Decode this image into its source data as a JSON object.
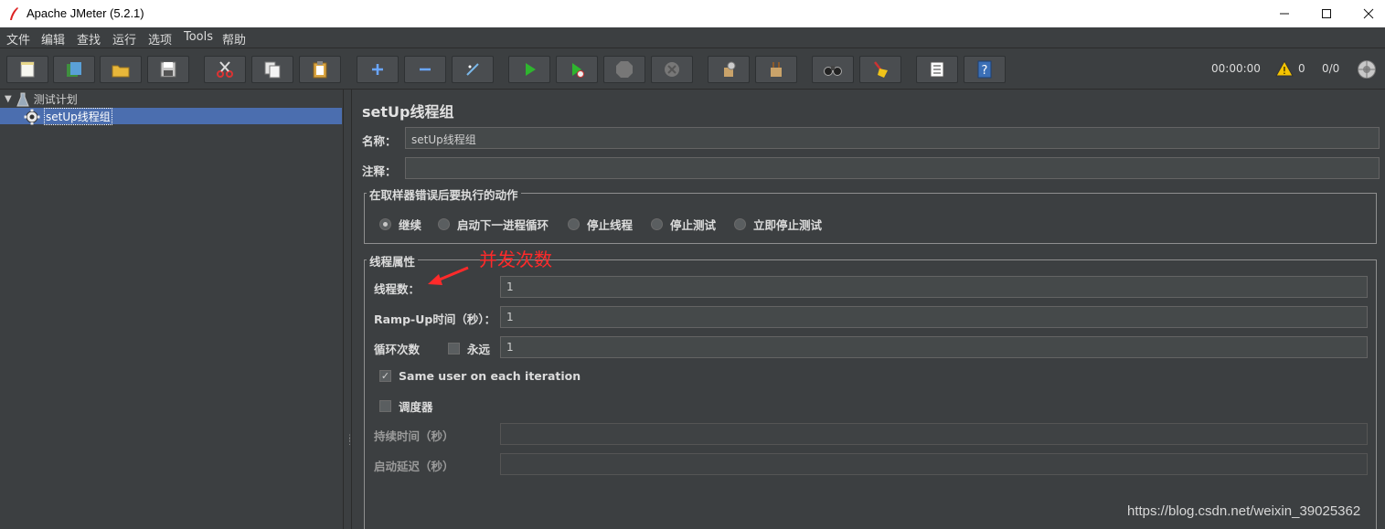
{
  "window": {
    "title": "Apache JMeter (5.2.1)"
  },
  "menu": [
    "文件",
    "编辑",
    "查找",
    "运行",
    "选项",
    "Tools",
    "帮助"
  ],
  "toolbar": {
    "timer": "00:00:00",
    "warnings": "0",
    "threads": "0/0"
  },
  "tree": {
    "root": "测试计划",
    "child": "setUp线程组"
  },
  "panel": {
    "title": "setUp线程组",
    "name_label": "名称：",
    "name_value": "setUp线程组",
    "comment_label": "注释：",
    "comment_value": "",
    "error_group_title": "在取样器错误后要执行的动作",
    "error_options": [
      "继续",
      "启动下一进程循环",
      "停止线程",
      "停止测试",
      "立即停止测试"
    ],
    "thread_group_title": "线程属性",
    "threads_label": "线程数：",
    "threads_value": "1",
    "rampup_label": "Ramp-Up时间（秒）：",
    "rampup_value": "1",
    "loop_label": "循环次数",
    "forever_label": "永远",
    "loop_value": "1",
    "same_user_label": "Same user on each iteration",
    "scheduler_label": "调度器",
    "duration_label": "持续时间（秒）",
    "delay_label": "启动延迟（秒）"
  },
  "annotation": {
    "text": "并发次数",
    "color": "#ff2a2a"
  },
  "watermark": "https://blog.csdn.net/weixin_39025362"
}
